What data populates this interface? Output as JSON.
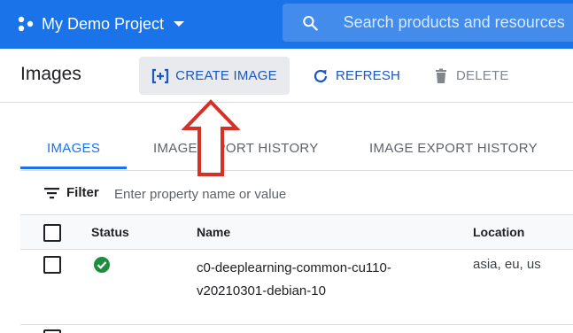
{
  "header": {
    "project_name": "My Demo Project",
    "search_placeholder": "Search products and resources"
  },
  "actions": {
    "title": "Images",
    "create_label": "CREATE IMAGE",
    "refresh_label": "REFRESH",
    "delete_label": "DELETE"
  },
  "tabs": [
    {
      "label": "IMAGES",
      "active": true
    },
    {
      "label": "IMAGE IMPORT HISTORY",
      "active": false
    },
    {
      "label": "IMAGE EXPORT HISTORY",
      "active": false
    }
  ],
  "filter": {
    "label": "Filter",
    "placeholder": "Enter property name or value"
  },
  "table": {
    "columns": [
      "Status",
      "Name",
      "Location"
    ],
    "rows": [
      {
        "status": "ok",
        "name_line1": "c0-deeplearning-common-cu110-",
        "name_line2": "v20210301-debian-10",
        "location": "asia, eu, us"
      }
    ]
  },
  "colors": {
    "header_bg": "#1a73e8",
    "accent": "#1a73e8",
    "status_ok": "#1e8e3e",
    "annotation_arrow": "#d93025"
  }
}
